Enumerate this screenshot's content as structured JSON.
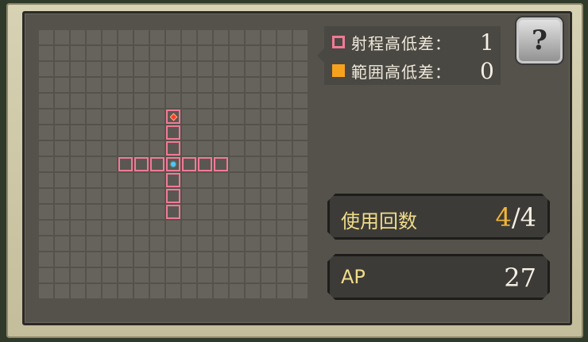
{
  "legend": {
    "range_height": {
      "label": "射程高低差：",
      "value": "1",
      "color": "#f07a96"
    },
    "area_height": {
      "label": "範囲高低差：",
      "value": "0",
      "color": "#f7a21c"
    }
  },
  "help_icon": "?",
  "uses": {
    "label": "使用回数",
    "current": "4",
    "separator": "/",
    "max": "4"
  },
  "ap": {
    "label": "AP",
    "value": "27"
  },
  "grid": {
    "columns": 17,
    "rows": 17,
    "center": [
      8,
      8
    ],
    "target": [
      8,
      5
    ],
    "range_cells": [
      [
        8,
        5
      ],
      [
        8,
        6
      ],
      [
        8,
        7
      ],
      [
        5,
        8
      ],
      [
        6,
        8
      ],
      [
        7,
        8
      ],
      [
        9,
        8
      ],
      [
        10,
        8
      ],
      [
        11,
        8
      ],
      [
        8,
        9
      ],
      [
        8,
        10
      ],
      [
        8,
        11
      ]
    ]
  }
}
